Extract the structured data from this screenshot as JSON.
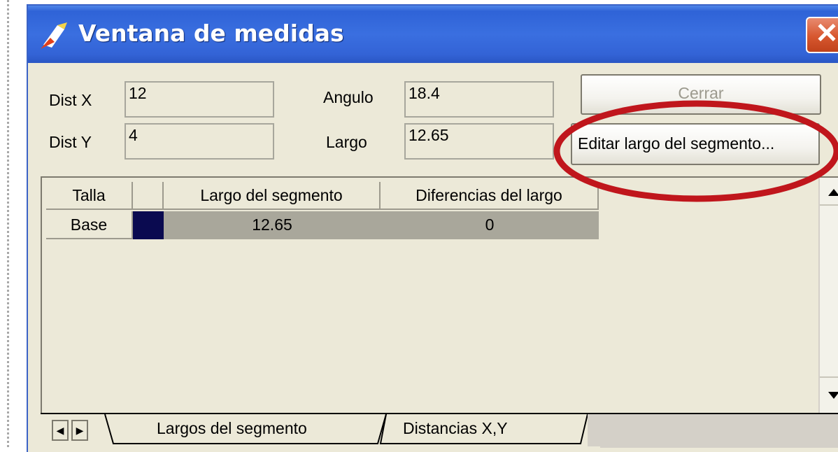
{
  "window": {
    "title": "Ventana de medidas",
    "close_glyph": "✕"
  },
  "measures": {
    "dist_x_label": "Dist X",
    "dist_x_value": "12",
    "dist_y_label": "Dist Y",
    "dist_y_value": "4",
    "angulo_label": "Angulo",
    "angulo_value": "18.4",
    "largo_label": "Largo",
    "largo_value": "12.65"
  },
  "buttons": {
    "top_label": "Cerrar",
    "edit_label": "Editar largo del segmento..."
  },
  "grid": {
    "columns": [
      "Talla",
      "",
      "Largo del segmento",
      "Diferencias del largo"
    ],
    "rows": [
      {
        "talla": "Base",
        "color": "#0a0a50",
        "largo": "12.65",
        "diferencia": "0"
      }
    ]
  },
  "tabs": {
    "items": [
      "Largos del segmento",
      "Distancias X,Y"
    ],
    "active": "Largos del segmento"
  },
  "annotation": {
    "color": "#c0161c"
  },
  "icons": {
    "app": "measure-icon",
    "scroll_up": "arrow-up-icon",
    "scroll_down": "arrow-down-icon",
    "tab_prev": "arrow-left-icon",
    "tab_next": "arrow-right-icon"
  }
}
